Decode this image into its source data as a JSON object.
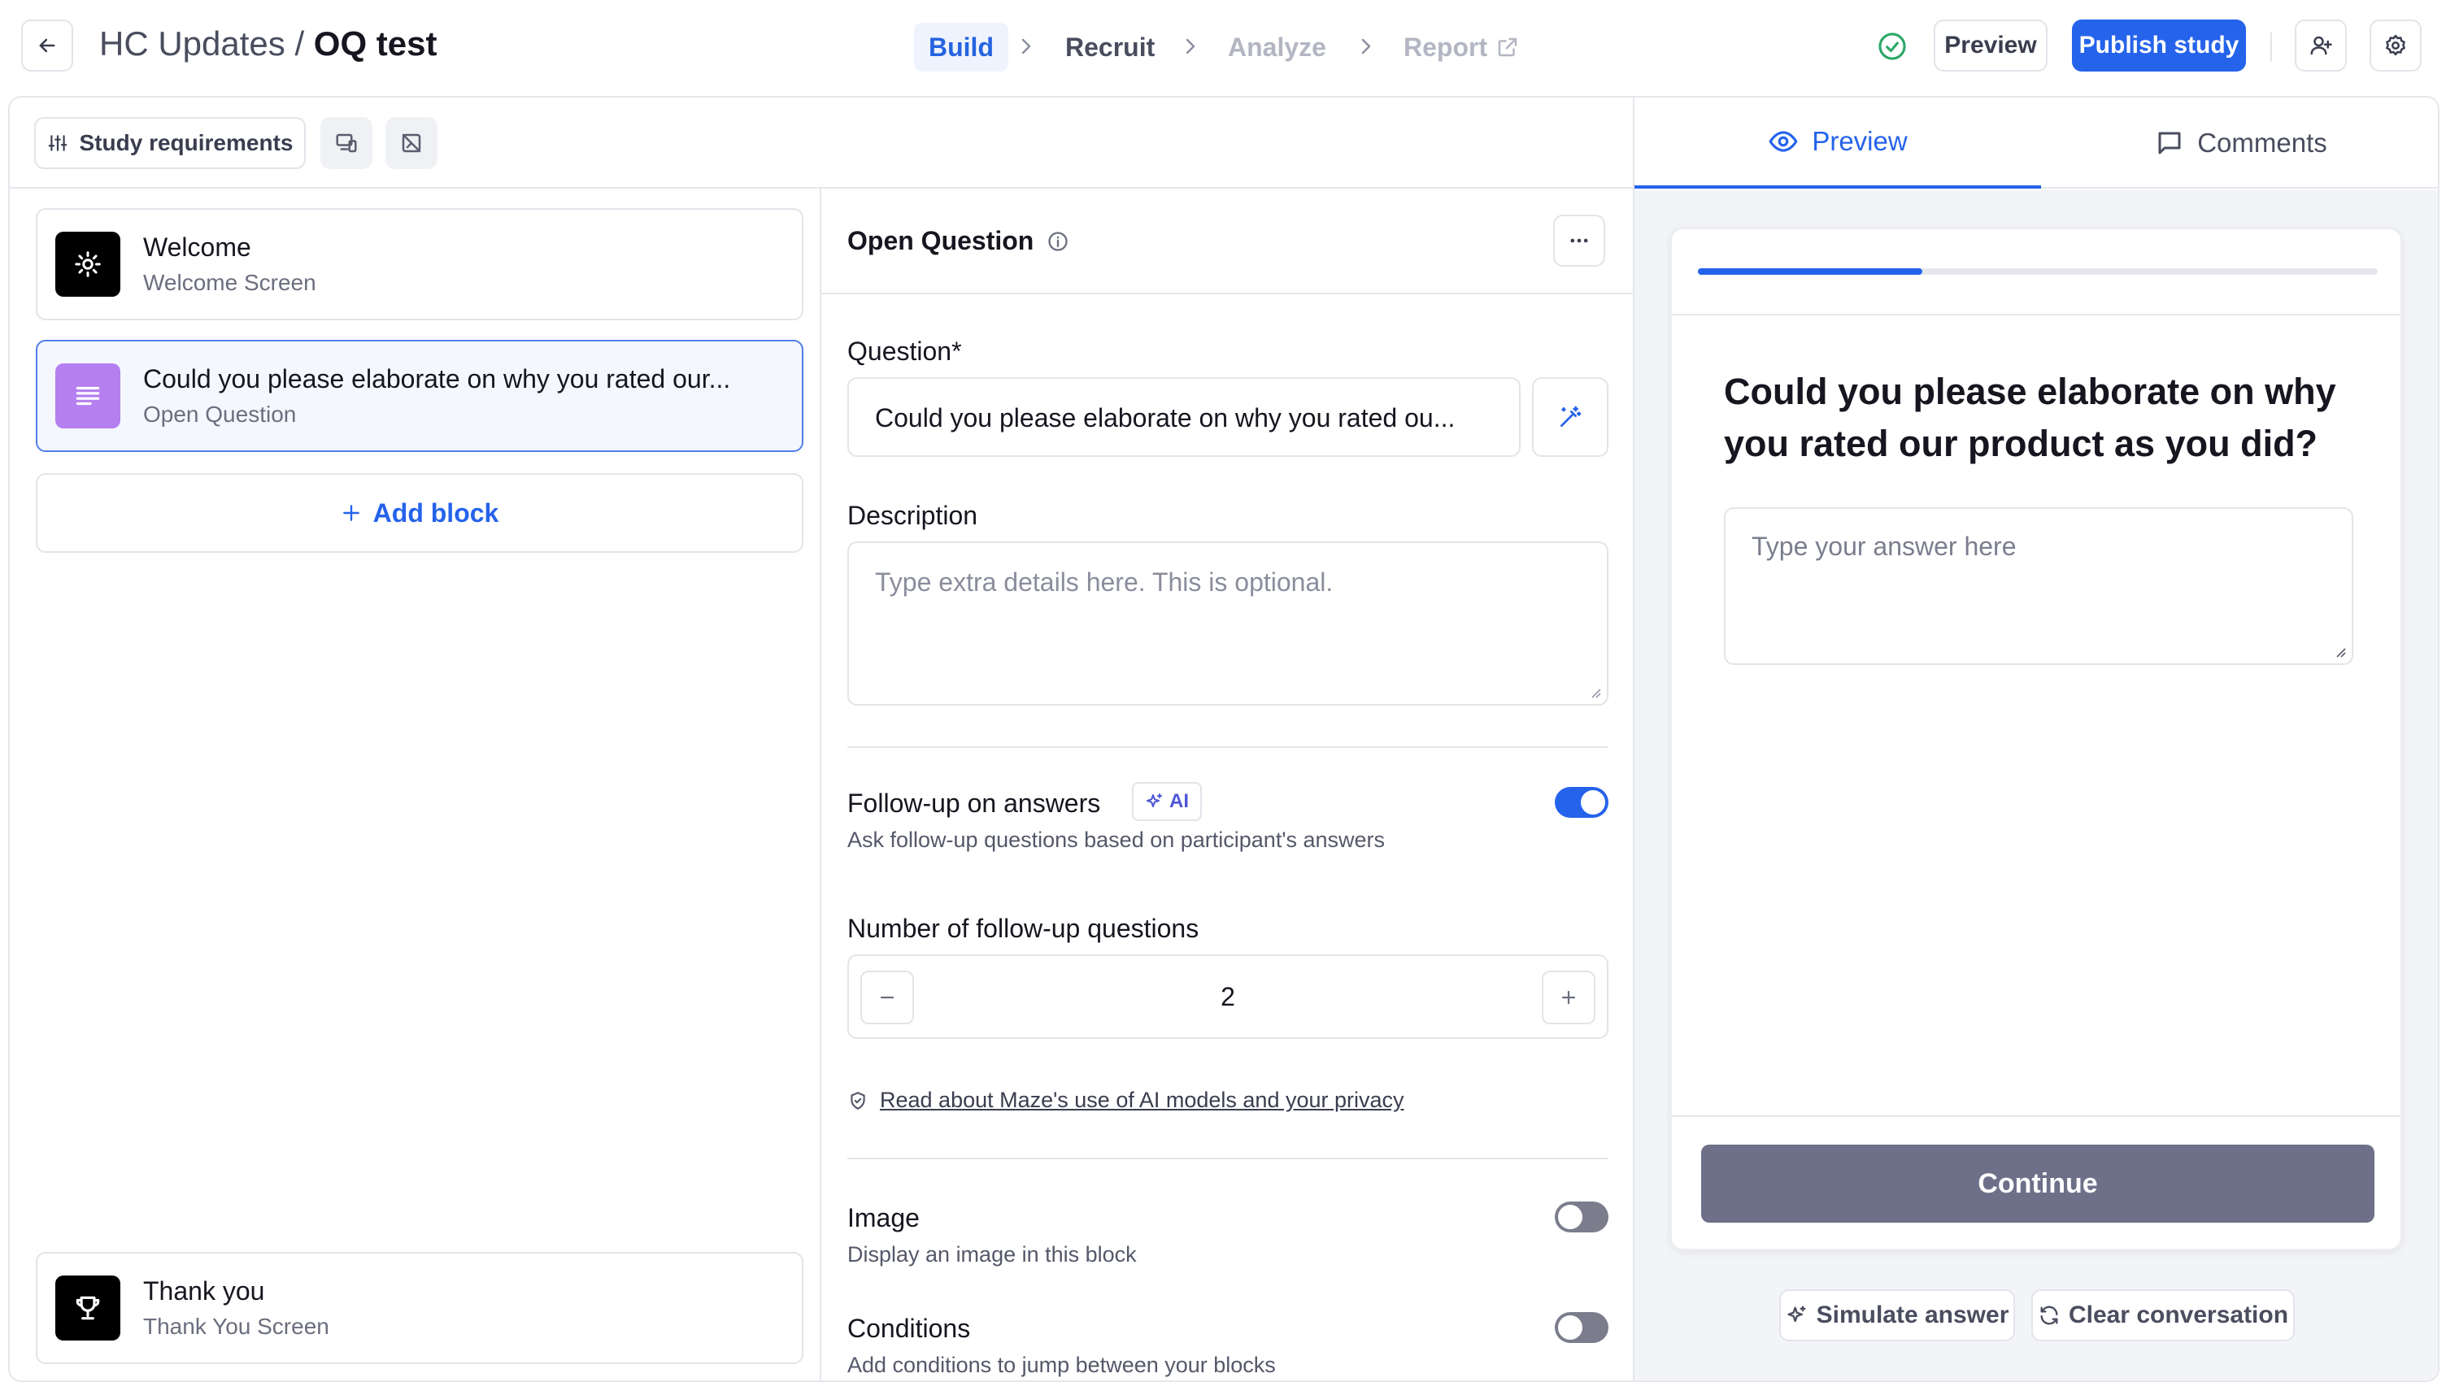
{
  "header": {
    "project": "HC Updates",
    "separator": "/",
    "study": "OQ test",
    "steps": [
      "Build",
      "Recruit",
      "Analyze",
      "Report"
    ],
    "preview_label": "Preview",
    "publish_label": "Publish study"
  },
  "toolbar": {
    "study_requirements_label": "Study requirements"
  },
  "blocks": [
    {
      "title": "Welcome",
      "subtitle": "Welcome Screen"
    },
    {
      "title": "Could you please elaborate on why you rated our...",
      "subtitle": "Open Question"
    }
  ],
  "add_block_label": "Add block",
  "end_block": {
    "title": "Thank you",
    "subtitle": "Thank You Screen"
  },
  "editor": {
    "title": "Open Question",
    "question_label": "Question*",
    "question_value": "Could you please elaborate on why you rated ou...",
    "description_label": "Description",
    "description_placeholder": "Type extra details here. This is optional.",
    "followup_label": "Follow-up on answers",
    "ai_badge": "AI",
    "followup_desc": "Ask follow-up questions based on participant's answers",
    "followup_enabled": true,
    "num_followups_label": "Number of follow-up questions",
    "num_followups_value": "2",
    "privacy_link": "Read about Maze's use of AI models and your privacy",
    "image_label": "Image",
    "image_desc": "Display an image in this block",
    "image_enabled": false,
    "conditions_label": "Conditions",
    "conditions_desc": "Add conditions to jump between your blocks",
    "conditions_enabled": false
  },
  "preview_panel": {
    "tabs": [
      "Preview",
      "Comments"
    ],
    "active_tab": "Preview",
    "progress": 0.33,
    "question": "Could you please elaborate on why you rated our product as you did?",
    "answer_placeholder": "Type your answer here",
    "continue_label": "Continue",
    "simulate_label": "Simulate answer",
    "clear_label": "Clear conversation"
  },
  "colors": {
    "accent": "#2563eb",
    "open_question_icon": "#b57ff0",
    "continue_button": "#6e6f88"
  }
}
